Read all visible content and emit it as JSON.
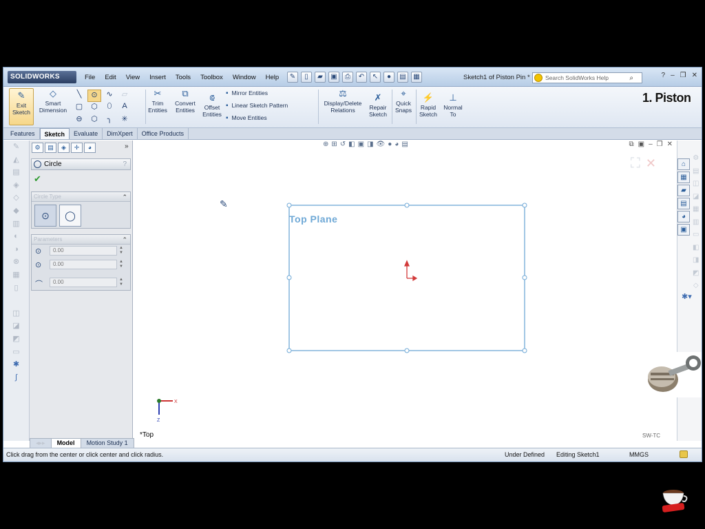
{
  "app": {
    "brand": "SOLIDWORKS",
    "menu": [
      "File",
      "Edit",
      "View",
      "Insert",
      "Tools",
      "Toolbox",
      "Window",
      "Help"
    ],
    "doc_title": "Sketch1 of Piston Pin *",
    "search_placeholder": "Search SolidWorks Help",
    "overlay_title": "1. Piston"
  },
  "command_manager": {
    "exit_sketch": "Exit Sketch",
    "smart_dimension": "Smart Dimension",
    "trim_entities": "Trim Entities",
    "convert_entities": "Convert Entities",
    "offset_entities": "Offset Entities",
    "mirror_entities": "Mirror Entities",
    "linear_sketch_pattern": "Linear Sketch Pattern",
    "move_entities": "Move Entities",
    "display_delete_relations": "Display/Delete Relations",
    "repair_sketch": "Repair Sketch",
    "quick_snaps": "Quick Snaps",
    "rapid_sketch": "Rapid Sketch",
    "normal_to": "Normal To"
  },
  "tabs": [
    "Features",
    "Sketch",
    "Evaluate",
    "DimXpert",
    "Office Products"
  ],
  "active_tab": "Sketch",
  "property_manager": {
    "title": "Circle",
    "circle_type_label": "Circle Type",
    "parameters_label": "Parameters",
    "cx": "0.00",
    "cy": "0.00",
    "radius": "0.00"
  },
  "graphics": {
    "plane_label": "Top Plane",
    "view_label": "*Top",
    "watermark": "SW-TC"
  },
  "bottom_tabs": [
    "Model",
    "Motion Study 1"
  ],
  "status": {
    "hint": "Click drag from the center or click center and click radius.",
    "definition": "Under Defined",
    "editing": "Editing Sketch1",
    "units": "MMGS"
  }
}
